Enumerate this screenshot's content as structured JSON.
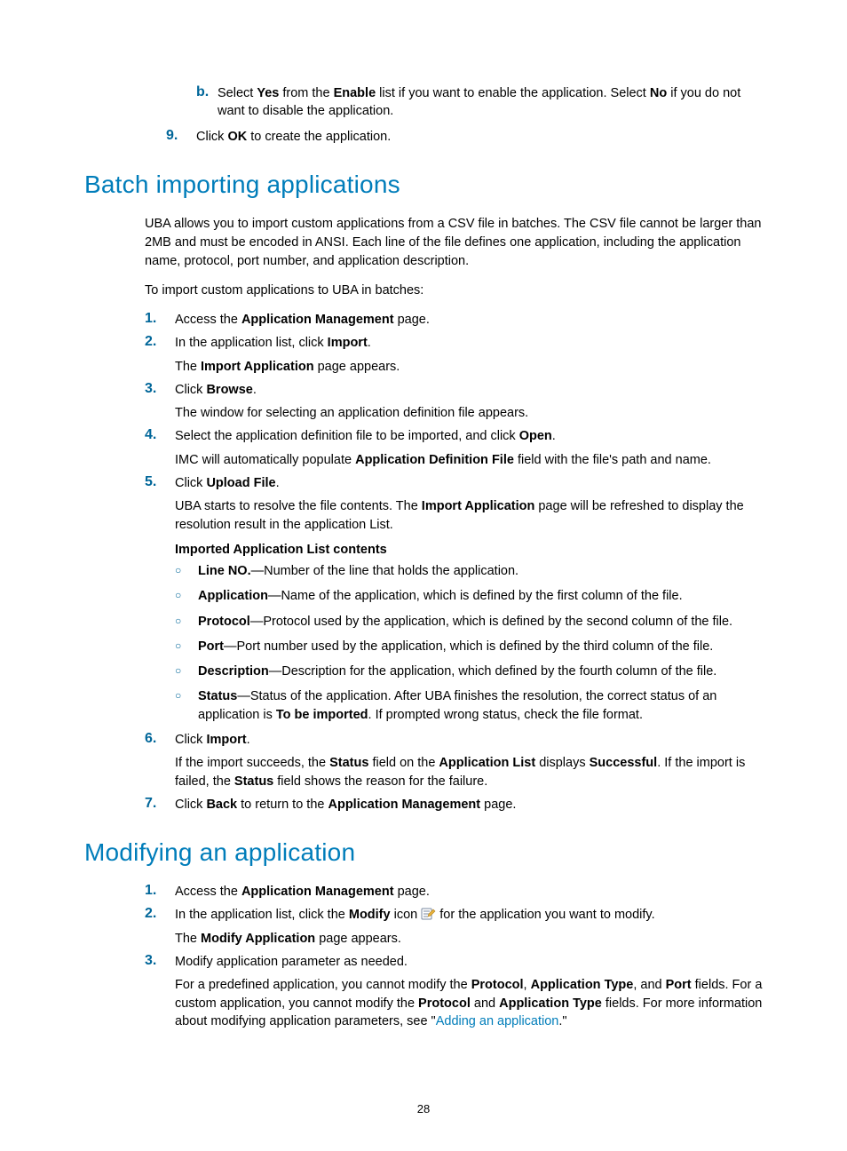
{
  "topB": {
    "marker": "b.",
    "text_pre": "Select ",
    "yes": "Yes",
    "mid1": " from the ",
    "enable": "Enable",
    "mid2": " list if you want to enable the application. Select ",
    "no": "No",
    "mid3": " if you do not want to disable the application."
  },
  "top9": {
    "marker": "9.",
    "pre": "Click ",
    "ok": "OK",
    "post": " to create the application."
  },
  "section1": {
    "heading": "Batch importing applications",
    "intro": "UBA allows you to import custom applications from a CSV file in batches. The CSV file cannot be larger than 2MB and must be encoded in ANSI. Each line of the file defines one application, including the application name, protocol, port number, and application description.",
    "lead": "To import custom applications to UBA in batches:",
    "s1": {
      "m": "1.",
      "pre": "Access the ",
      "b": "Application Management",
      "post": " page."
    },
    "s2": {
      "m": "2.",
      "pre": "In the application list, click ",
      "b": "Import",
      "post": ".",
      "sub_pre": "The ",
      "sub_b": "Import Application",
      "sub_post": " page appears."
    },
    "s3": {
      "m": "3.",
      "pre": "Click ",
      "b": "Browse",
      "post": ".",
      "sub": "The window for selecting an application definition file appears."
    },
    "s4": {
      "m": "4.",
      "pre": "Select the application definition file to be imported, and click ",
      "b": "Open",
      "post": ".",
      "sub_pre": "IMC will automatically populate ",
      "sub_b": "Application Definition File",
      "sub_post": " field with the file's path and name."
    },
    "s5": {
      "m": "5.",
      "pre": "Click ",
      "b": "Upload File",
      "post": ".",
      "sub_pre": "UBA starts to resolve the file contents. The ",
      "sub_b": "Import Application",
      "sub_post": " page will be refreshed to display the resolution result in the application List.",
      "heading": "Imported Application List contents",
      "items": [
        {
          "b": "Line NO.",
          "t": "—Number of the line that holds the application."
        },
        {
          "b": "Application",
          "t": "—Name of the application, which is defined by the first column of the file."
        },
        {
          "b": "Protocol",
          "t": "—Protocol used by the application, which is defined by the second column of the file."
        },
        {
          "b": "Port",
          "t": "—Port number used by the application, which is defined by the third column of the file."
        },
        {
          "b": "Description",
          "t": "—Description for the application, which defined by the fourth column of the file."
        },
        {
          "b": "Status",
          "t1": "—Status of the application. After UBA finishes the resolution, the correct status of an application is ",
          "b2": "To be imported",
          "t2": ". If prompted wrong status, check the file format."
        }
      ]
    },
    "s6": {
      "m": "6.",
      "pre": "Click ",
      "b": "Import",
      "post": ".",
      "sub_pre": "If the import succeeds, the ",
      "sub_b1": "Status",
      "sub_mid1": " field on the ",
      "sub_b2": "Application List",
      "sub_mid2": " displays ",
      "sub_b3": "Successful",
      "sub_mid3": ". If the import is failed, the ",
      "sub_b4": "Status",
      "sub_post": " field shows the reason for the failure."
    },
    "s7": {
      "m": "7.",
      "pre": "Click ",
      "b1": "Back",
      "mid": " to return to the ",
      "b2": "Application Management",
      "post": " page."
    }
  },
  "section2": {
    "heading": "Modifying an application",
    "s1": {
      "m": "1.",
      "pre": "Access the ",
      "b": "Application Management",
      "post": " page."
    },
    "s2": {
      "m": "2.",
      "pre": "In the application list, click the ",
      "b": "Modify",
      "mid": " icon ",
      "post": " for the application you want to modify.",
      "sub_pre": "The ",
      "sub_b": "Modify Application",
      "sub_post": " page appears."
    },
    "s3": {
      "m": "3.",
      "line": "Modify application parameter as needed.",
      "sub_pre": "For a predefined application, you cannot modify the ",
      "b1": "Protocol",
      "c1": ", ",
      "b2": "Application Type",
      "c2": ", and ",
      "b3": "Port",
      "c3": " fields. For a custom application, you cannot modify the ",
      "b4": "Protocol",
      "c4": " and ",
      "b5": "Application Type",
      "c5": " fields. For more information about modifying application parameters, see \"",
      "link": "Adding an application",
      "sub_post": ".\""
    }
  },
  "pageNumber": "28"
}
